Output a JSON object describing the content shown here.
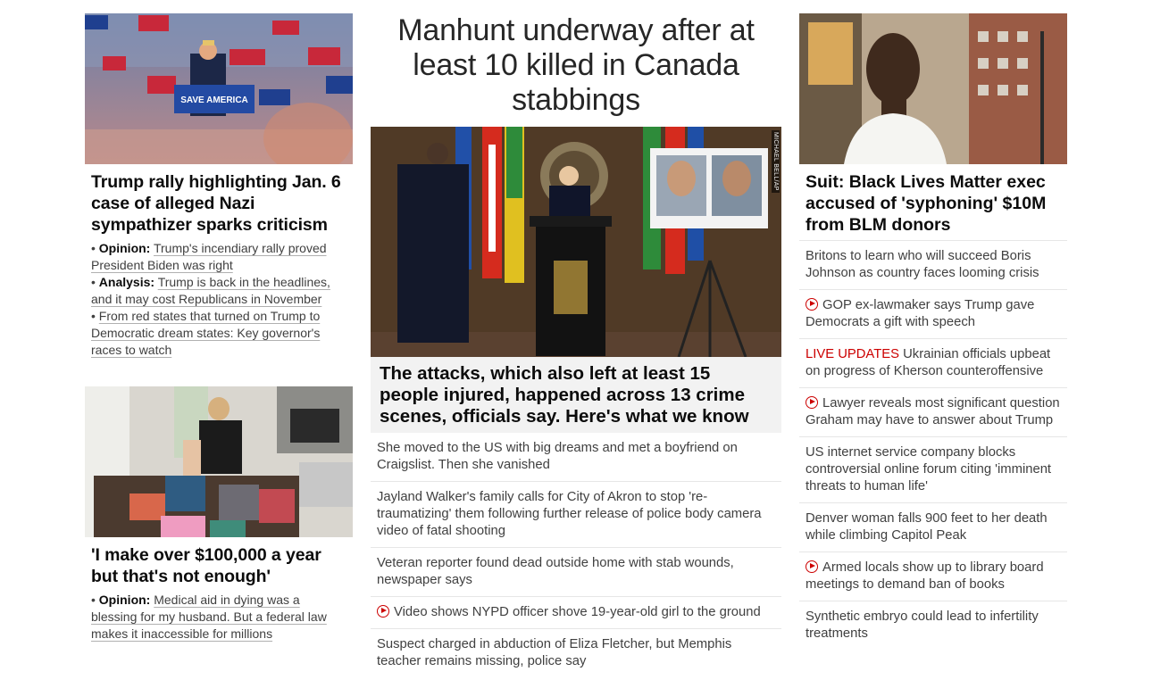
{
  "left": {
    "story1": {
      "headline": "Trump rally highlighting Jan. 6 case of alleged Nazi sympathizer sparks criticism",
      "image_alt": "Trump rally crowd with Save America signs",
      "image_sign_text": "SAVE AMERICA",
      "related": [
        {
          "prefix": "Opinion:",
          "text": "Trump's incendiary rally proved President Biden was right"
        },
        {
          "prefix": "Analysis:",
          "text": "Trump is back in the headlines, and it may cost Republicans in November"
        },
        {
          "prefix": "",
          "text": "From red states that turned on Trump to Democratic dream states: Key governor's races to watch"
        }
      ]
    },
    "story2": {
      "headline": "'I make over $100,000 a year but that's not enough'",
      "image_alt": "Woman packing school backpacks",
      "related": [
        {
          "prefix": "Opinion:",
          "text": "Medical aid in dying was a blessing for my husband. But a federal law makes it inaccessible for millions"
        }
      ]
    }
  },
  "middle": {
    "headline": "Manhunt underway after at least 10 killed in Canada stabbings",
    "image_alt": "RCMP press conference with suspect photos",
    "photo_credit": "MICHAEL BELL/AP",
    "lead": "The attacks, which also left at least 15 people injured, happened across 13 crime scenes, officials say. Here's what we know",
    "stories": [
      {
        "text": "She moved to the US with big dreams and met a boyfriend on Craigslist. Then she vanished",
        "video": false
      },
      {
        "text": "Jayland Walker's family calls for City of Akron to stop 're-traumatizing' them following further release of police body camera video of fatal shooting",
        "video": false
      },
      {
        "text": "Veteran reporter found dead outside home with stab wounds, newspaper says",
        "video": false
      },
      {
        "text": "Video shows NYPD officer shove 19-year-old girl to the ground",
        "video": true
      },
      {
        "text": "Suspect charged in abduction of Eliza Fletcher, but Memphis teacher remains missing, police say",
        "video": false
      }
    ]
  },
  "right": {
    "headline": "Suit: Black Lives Matter exec accused of 'syphoning' $10M from BLM donors",
    "image_alt": "Man in white t-shirt on city street",
    "stories": [
      {
        "text": "Britons to learn who will succeed Boris Johnson as country faces looming crisis",
        "video": false,
        "live": ""
      },
      {
        "text": "GOP ex-lawmaker says Trump gave Democrats a gift with speech",
        "video": true,
        "live": ""
      },
      {
        "text": "Ukrainian officials upbeat on progress of Kherson counteroffensive",
        "video": false,
        "live": "LIVE UPDATES"
      },
      {
        "text": "Lawyer reveals most significant question Graham may have to answer about Trump",
        "video": true,
        "live": ""
      },
      {
        "text": "US internet service company blocks controversial online forum citing 'imminent threats to human life'",
        "video": false,
        "live": ""
      },
      {
        "text": "Denver woman falls 900 feet to her death while climbing Capitol Peak",
        "video": false,
        "live": ""
      },
      {
        "text": "Armed locals show up to library board meetings to demand ban of books",
        "video": true,
        "live": ""
      },
      {
        "text": "Synthetic embryo could lead to infertility treatments",
        "video": false,
        "live": ""
      }
    ]
  },
  "colors": {
    "live_red": "#cc0000",
    "lead_bg": "#f2f2f2",
    "text": "#404040"
  }
}
